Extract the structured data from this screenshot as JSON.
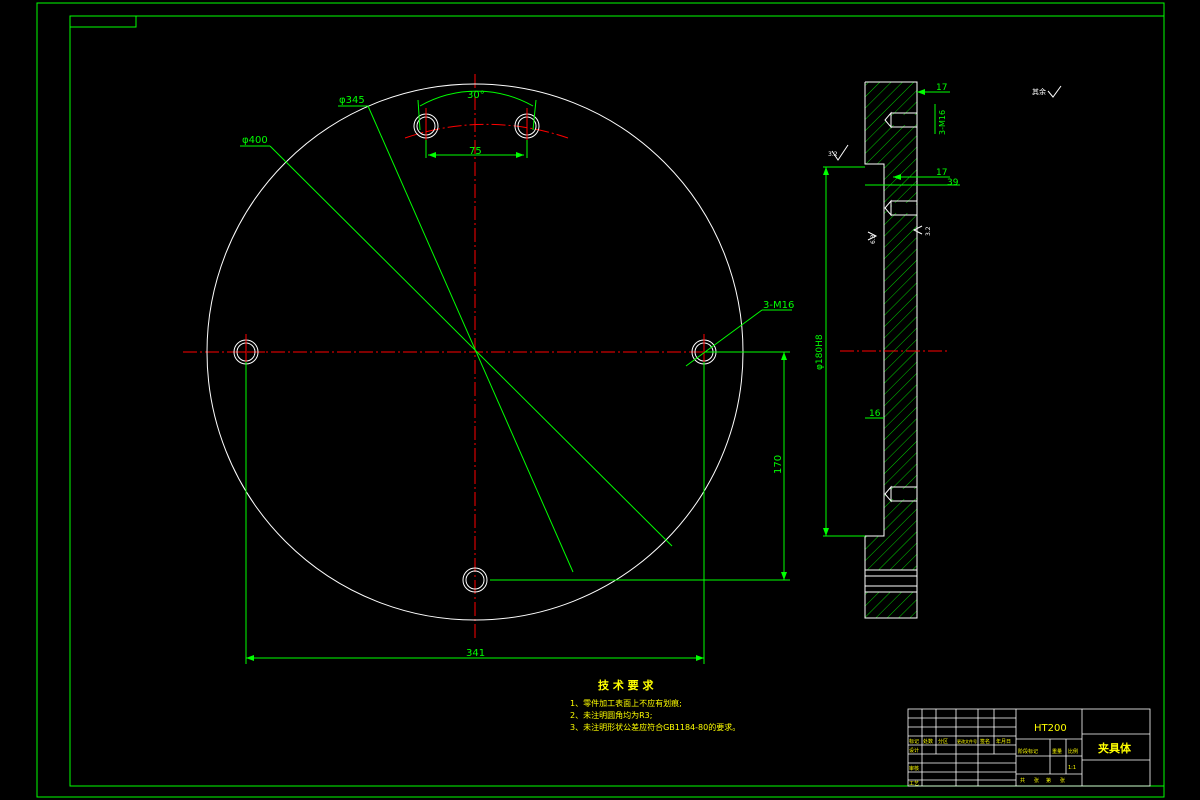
{
  "drawing": {
    "background": "#000000",
    "frame_color": "#00ff00",
    "outline_color": "#ffffff",
    "dimension_color": "#00ff00",
    "centerline_color": "#ff0000",
    "hatch_color": "#00ff00",
    "note_color": "#ffff00"
  },
  "front_view": {
    "dims": {
      "d400": "φ400",
      "d345": "φ345",
      "angle30": "30°",
      "w75": "75",
      "m16": "3-M16",
      "h170": "170",
      "w341": "341"
    }
  },
  "side_view": {
    "dims": {
      "t17_top": "17",
      "t17_mid": "17",
      "t39": "39",
      "t16": "16",
      "m16": "3-M16",
      "d180": "φ180H8",
      "ra_left": "6.3",
      "ra_right": "3.2",
      "ra_top": "3.2"
    }
  },
  "corner_mark": "其余",
  "technical_requirements": {
    "title": "技 术 要 求",
    "items": [
      "1、零件加工表面上不应有划痕;",
      "2、未注明圆角均为R3;",
      "3、未注明形状公差应符合GB1184-80的要求。"
    ]
  },
  "title_block": {
    "material": "HT200",
    "part_name": "夹具体",
    "row_labels": [
      "标记",
      "处数",
      "分区",
      "更改文件号",
      "签名",
      "年月日"
    ],
    "side_labels": [
      "设计",
      "审核",
      "工艺"
    ],
    "right_labels": [
      "阶段标记",
      "重量",
      "比例"
    ],
    "scale": "1:1",
    "sheet_labels": [
      "共",
      "张",
      "第",
      "张"
    ]
  }
}
